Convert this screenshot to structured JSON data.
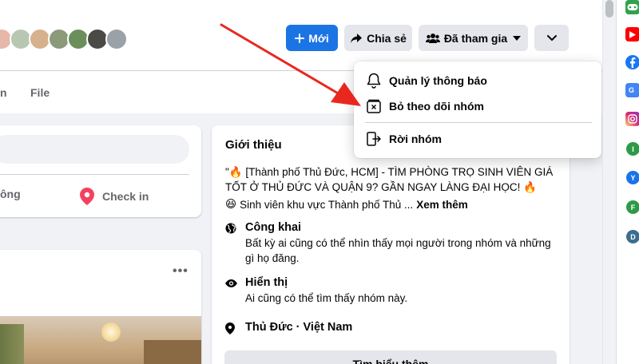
{
  "header": {
    "new_label": "Mới",
    "share_label": "Chia sẻ",
    "joined_label": "Đã tham gia"
  },
  "nav": {
    "partial_tab": "n",
    "files_tab": "File"
  },
  "composer": {
    "partial_action": "ông",
    "checkin_label": "Check in"
  },
  "post": {
    "more_dots": "•••"
  },
  "intro": {
    "title": "Giới thiệu",
    "description": "\"🔥 [Thành phố Thủ Đức, HCM] - TÌM PHÒNG TRỌ SINH VIÊN GIÁ TỐT Ở THỦ ĐỨC VÀ QUẬN 9? GẦN NGAY LÀNG ĐẠI HỌC! 🔥",
    "more_emoji": "😆",
    "more_text": "Sinh viên khu vực Thành phố Thủ ...",
    "more_link": "Xem thêm",
    "public_title": "Công khai",
    "public_desc": "Bất kỳ ai cũng có thể nhìn thấy mọi người trong nhóm và những gì họ đăng.",
    "visible_title": "Hiển thị",
    "visible_desc": "Ai cũng có thể tìm thấy nhóm này.",
    "location": "Thủ Đức · Việt Nam",
    "learn_more": "Tìm hiểu thêm"
  },
  "menu": {
    "items": [
      {
        "label": "Quản lý thông báo",
        "icon": "bell-icon"
      },
      {
        "label": "Bỏ theo dõi nhóm",
        "icon": "unfollow-icon"
      },
      {
        "label": "Rời nhóm",
        "icon": "leave-icon"
      }
    ]
  },
  "rail": {
    "dots": [
      "I",
      "Y",
      "F",
      "D"
    ]
  },
  "colors": {
    "primary": "#1b74e4",
    "arrow": "#e8281f",
    "secondary_button": "#e4e6eb"
  }
}
